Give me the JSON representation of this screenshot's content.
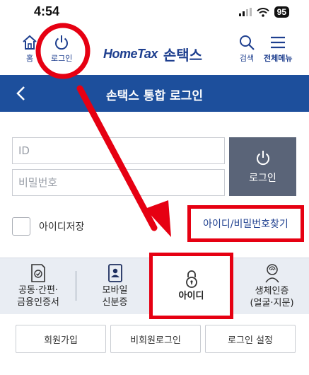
{
  "status_bar": {
    "time": "4:54",
    "battery": "95"
  },
  "header": {
    "home_label": "홈",
    "login_label": "로그인",
    "logo_en": "HomeTax",
    "logo_ko": "손택스",
    "search_label": "검색",
    "menu_label": "전체메뉴"
  },
  "title_bar": {
    "title": "손택스 통합 로그인"
  },
  "login_form": {
    "id_placeholder": "ID",
    "pw_placeholder": "비밀번호",
    "submit_label": "로그인",
    "save_id_label": "아이디저장",
    "find_link": "아이디/비밀번호찾기"
  },
  "auth_tabs": [
    {
      "label": "공동·간편·\n금융인증서",
      "icon": "certificate-icon"
    },
    {
      "label": "모바일\n신분증",
      "icon": "mobile-id-icon"
    },
    {
      "label": "아이디",
      "icon": "lock-icon",
      "selected": true
    },
    {
      "label": "생체인증\n(얼굴·지문)",
      "icon": "fingerprint-face-icon"
    }
  ],
  "bottom_buttons": [
    "회원가입",
    "비회원로그인",
    "로그인 설정"
  ],
  "colors": {
    "brand_blue": "#1d4f9c",
    "annotation_red": "#e60012",
    "submit_gray": "#5a6478"
  }
}
